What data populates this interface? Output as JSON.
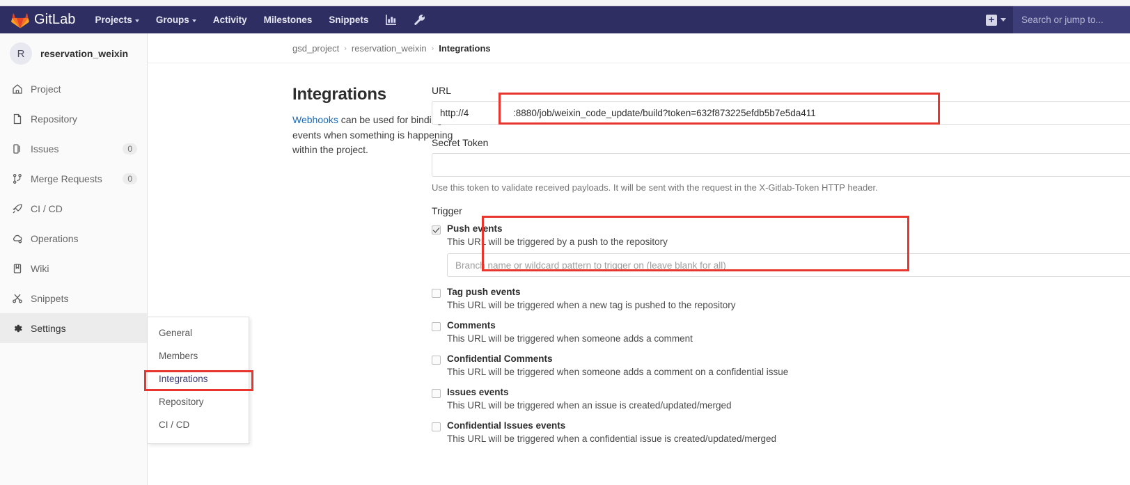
{
  "navbar": {
    "brand": "GitLab",
    "logo_icon": "gitlab-fox-logo",
    "links": [
      {
        "label": "Projects",
        "has_caret": true
      },
      {
        "label": "Groups",
        "has_caret": true
      },
      {
        "label": "Activity",
        "has_caret": false
      },
      {
        "label": "Milestones",
        "has_caret": false
      },
      {
        "label": "Snippets",
        "has_caret": false
      }
    ],
    "icon_buttons": [
      {
        "name": "analytics-chart-icon"
      },
      {
        "name": "wrench-admin-icon"
      }
    ],
    "plus_button": {
      "glyph": "+",
      "name": "new-item-plus-icon"
    },
    "search": {
      "placeholder": "Search or jump to..."
    }
  },
  "sidebar": {
    "project": {
      "initial": "R",
      "name": "reservation_weixin"
    },
    "items": [
      {
        "label": "Project",
        "icon": "home-icon",
        "badge": ""
      },
      {
        "label": "Repository",
        "icon": "document-icon",
        "badge": ""
      },
      {
        "label": "Issues",
        "icon": "issue-book-icon",
        "badge": "0"
      },
      {
        "label": "Merge Requests",
        "icon": "merge-branch-icon",
        "badge": "0"
      },
      {
        "label": "CI / CD",
        "icon": "rocket-icon",
        "badge": ""
      },
      {
        "label": "Operations",
        "icon": "cloud-gear-icon",
        "badge": ""
      },
      {
        "label": "Wiki",
        "icon": "book-icon",
        "badge": ""
      },
      {
        "label": "Snippets",
        "icon": "scissors-icon",
        "badge": ""
      },
      {
        "label": "Settings",
        "icon": "gear-icon",
        "badge": ""
      }
    ],
    "submenu": {
      "items": [
        {
          "label": "General"
        },
        {
          "label": "Members"
        },
        {
          "label": "Integrations"
        },
        {
          "label": "Repository"
        },
        {
          "label": "CI / CD"
        }
      ],
      "selected": "Integrations"
    }
  },
  "breadcrumb": {
    "group": "gsd_project",
    "project": "reservation_weixin",
    "page": "Integrations",
    "separator": "›"
  },
  "page": {
    "title": "Integrations",
    "description_link": "Webhooks",
    "description_rest": " can be used for binding events when something is happening within the project."
  },
  "form": {
    "url": {
      "label": "URL",
      "value": "http://4                 :8880/job/weixin_code_update/build?token=632f873225efdb5b7e5da411"
    },
    "secret_token": {
      "label": "Secret Token",
      "value": "",
      "help": "Use this token to validate received payloads. It will be sent with the request in the X-Gitlab-Token HTTP header."
    },
    "trigger_label": "Trigger",
    "triggers": [
      {
        "title": "Push events",
        "description": "This URL will be triggered by a push to the repository",
        "checked": true,
        "branch_placeholder": "Branch name or wildcard pattern to trigger on (leave blank for all)",
        "branch_value": ""
      },
      {
        "title": "Tag push events",
        "description": "This URL will be triggered when a new tag is pushed to the repository",
        "checked": false
      },
      {
        "title": "Comments",
        "description": "This URL will be triggered when someone adds a comment",
        "checked": false
      },
      {
        "title": "Confidential Comments",
        "description": "This URL will be triggered when someone adds a comment on a confidential issue",
        "checked": false
      },
      {
        "title": "Issues events",
        "description": "This URL will be triggered when an issue is created/updated/merged",
        "checked": false
      },
      {
        "title": "Confidential Issues events",
        "description": "This URL will be triggered when a confidential issue is created/updated/merged",
        "checked": false
      }
    ]
  },
  "colors": {
    "navbar": "#2e2e63",
    "highlight": "#e8362f",
    "link": "#1b69b6",
    "sidebar_bg": "#fafafa"
  }
}
